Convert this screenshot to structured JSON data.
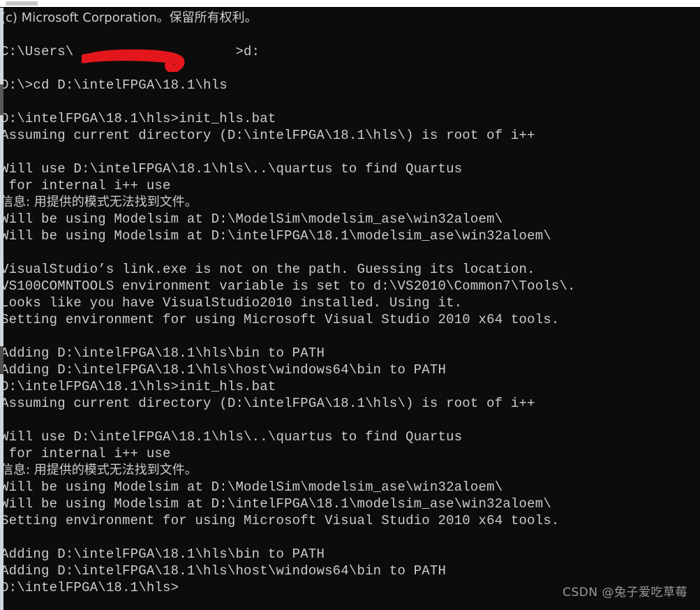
{
  "window": {
    "title": "Command Prompt",
    "background_color": "#0c0c0c",
    "text_color": "#cccccc"
  },
  "scrollbar": {
    "track_color": "#cfd6dc",
    "thumb_color": "#5a5a5a"
  },
  "terminal": {
    "lines": [
      "(c) Microsoft Corporation。保留所有权利。",
      "",
      "C:\\Users\\                    >d:",
      "",
      "D:\\>cd D:\\intelFPGA\\18.1\\hls",
      "",
      "D:\\intelFPGA\\18.1\\hls>init_hls.bat",
      "Assuming current directory (D:\\intelFPGA\\18.1\\hls\\) is root of i++",
      "",
      "Will use D:\\intelFPGA\\18.1\\hls\\..\\quartus to find Quartus",
      " for internal i++ use",
      "信息: 用提供的模式无法找到文件。",
      "Will be using Modelsim at D:\\ModelSim\\modelsim_ase\\win32aloem\\",
      "Will be using Modelsim at D:\\intelFPGA\\18.1\\modelsim_ase\\win32aloem\\",
      "",
      "VisualStudio’s link.exe is not on the path. Guessing its location.",
      "VS100COMNTOOLS environment variable is set to d:\\VS2010\\Common7\\Tools\\.",
      "Looks like you have VisualStudio2010 installed. Using it.",
      "Setting environment for using Microsoft Visual Studio 2010 x64 tools.",
      "",
      "Adding D:\\intelFPGA\\18.1\\hls\\bin to PATH",
      "Adding D:\\intelFPGA\\18.1\\hls\\host\\windows64\\bin to PATH",
      "D:\\intelFPGA\\18.1\\hls>init_hls.bat",
      "Assuming current directory (D:\\intelFPGA\\18.1\\hls\\) is root of i++",
      "",
      "Will use D:\\intelFPGA\\18.1\\hls\\..\\quartus to find Quartus",
      " for internal i++ use",
      "信息: 用提供的模式无法找到文件。",
      "Will be using Modelsim at D:\\ModelSim\\modelsim_ase\\win32aloem\\",
      "Will be using Modelsim at D:\\intelFPGA\\18.1\\modelsim_ase\\win32aloem\\",
      "Setting environment for using Microsoft Visual Studio 2010 x64 tools.",
      "",
      "Adding D:\\intelFPGA\\18.1\\hls\\bin to PATH",
      "Adding D:\\intelFPGA\\18.1\\hls\\host\\windows64\\bin to PATH",
      "D:\\intelFPGA\\18.1\\hls>"
    ],
    "cjk_line_indices": [
      0,
      11,
      27
    ],
    "prompt_line_index": 34
  },
  "redaction": {
    "color": "#e3171b",
    "description": "red marker scribble covering the Windows username"
  },
  "watermark": {
    "text": "CSDN @兔子爱吃草莓",
    "color": "#9a9a9a"
  }
}
